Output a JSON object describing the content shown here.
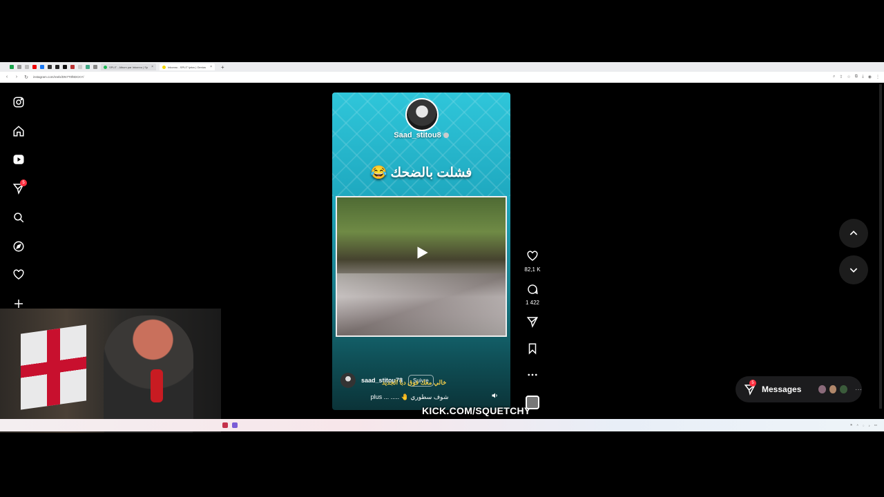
{
  "browser": {
    "tabs": [
      {
        "label": "SPLIT - Album par Inkonnu | Sp",
        "fav_color": "#1db954",
        "active": false
      },
      {
        "label": "Inkonnu - SPLIT lyrics | Genius",
        "fav_color": "#f5d800",
        "active": true
      }
    ],
    "url": "instagram.com/reels/DN7T0f8DCKY/"
  },
  "reel": {
    "handle": "Saad_stitou8",
    "caption_big": "فشلت بالضحك 😂",
    "author": "saad_stitou78",
    "follow_label": "Suivre",
    "description": "plus ... ..... 🤚 شوف سطوري",
    "overlay_arabic": "خالي معك فوق دبا الجديد",
    "watermark": "KICK.COM/SQUETCHY"
  },
  "actions": {
    "likes": "82,1 K",
    "comments": "1 422"
  },
  "notifications_count": "5",
  "messages": {
    "label": "Messages",
    "badge": "5"
  },
  "colors": {
    "accent": "#ff3040",
    "reel_top": "#2fc6da",
    "reel_bottom": "#0b3338"
  }
}
